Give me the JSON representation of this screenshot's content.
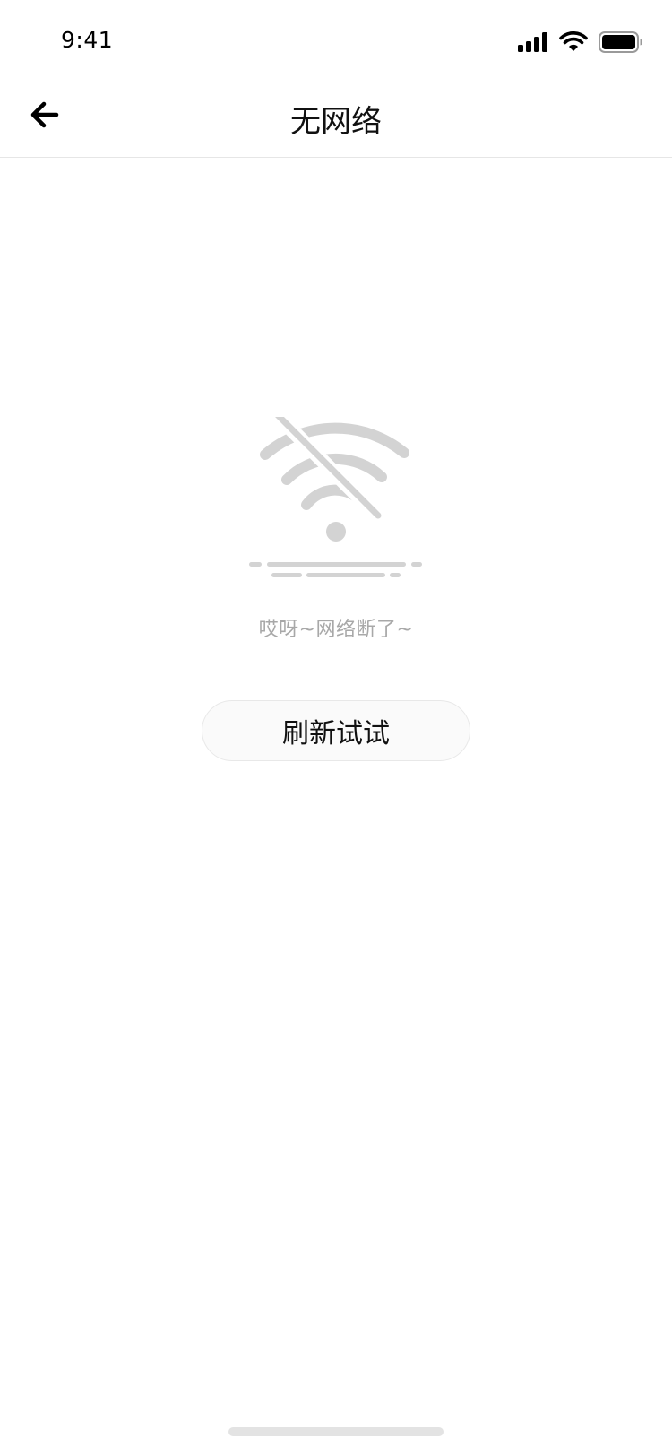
{
  "status_bar": {
    "time": "9:41",
    "icons": [
      "cellular-signal-icon",
      "wifi-icon",
      "battery-icon"
    ]
  },
  "header": {
    "back_icon": "arrow-left-icon",
    "title": "无网络"
  },
  "empty_state": {
    "illustration": "no-wifi-icon",
    "message": "哎呀~网络断了~",
    "retry_label": "刷新试试"
  },
  "colors": {
    "background": "#ffffff",
    "illustration": "#d3d3d3",
    "message_text": "#a8a8a8",
    "button_bg": "#fafafa",
    "button_border": "#e8e8e8",
    "divider": "#e6e6e6"
  }
}
